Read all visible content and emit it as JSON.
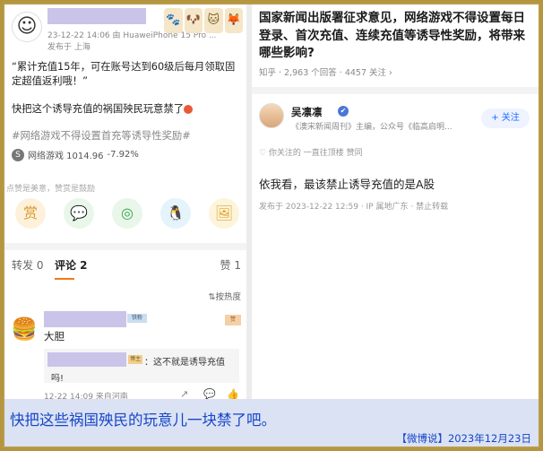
{
  "left_post": {
    "avatar_glyph": "☺",
    "meta_line": "23-12-22 14:06  由 HuaweiPhone 15 Pro ...",
    "published": "发布于 上海",
    "stickers": [
      "🐾",
      "🐶",
      "🐱",
      "🦊"
    ],
    "text1": "“累计充值15年，可在账号达到60级后每月领取固定超值返利哦！”",
    "text2": "快把这个诱导充值的祸国殃民玩意禁了",
    "hashtag": "#网络游戏不得设置首充等诱导性奖励#",
    "stock_icon": "S",
    "stock_label": "网络游戏 1014.96",
    "stock_change": "-7.92%",
    "like_hint": "点赞是美意，赞赏是鼓励",
    "share_icons": [
      "赏",
      "💬",
      "◎",
      "🐧",
      "🖼"
    ],
    "tab_repost": "转发 0",
    "tab_comment": "评论 2",
    "tab_like": "赞 1",
    "sort_label": "⇅按热度",
    "comment": {
      "avatar_glyph": "🍔",
      "badge": "铁粉",
      "like_badge": "赞",
      "text": "大胆",
      "reply_badge": "博主",
      "reply_text1": "：这不就是诱导充值",
      "reply_text2": "吗!",
      "footer": "12-22 14:09  来自河南",
      "actions": [
        "↗",
        "💬",
        "👍"
      ]
    }
  },
  "right_post": {
    "title": "国家新闻出版署征求意见，网络游戏不得设置每日登录、首次充值、连续充值等诱导性奖励，将带来哪些影响?",
    "meta": "知乎 · 2,963 个回答 · 4457 关注 ›",
    "author": "吴凛凛",
    "author_icon": "✔",
    "author_desc": "《澳宋新闻周刊》主编，公众号《临高启明...",
    "follow_label": "+ 关注",
    "fav_note": "♡ 你关注的 一直往顶楼 赞同",
    "answer": "依我看，最该禁止诱导充值的是A股",
    "answer_footer": "发布于 2023-12-22 12:59 · IP 属地广东 · 禁止转载"
  },
  "caption": {
    "text": "快把这些祸国殃民的玩意儿一块禁了吧。",
    "source": "【微博说】2023年12月23日"
  }
}
